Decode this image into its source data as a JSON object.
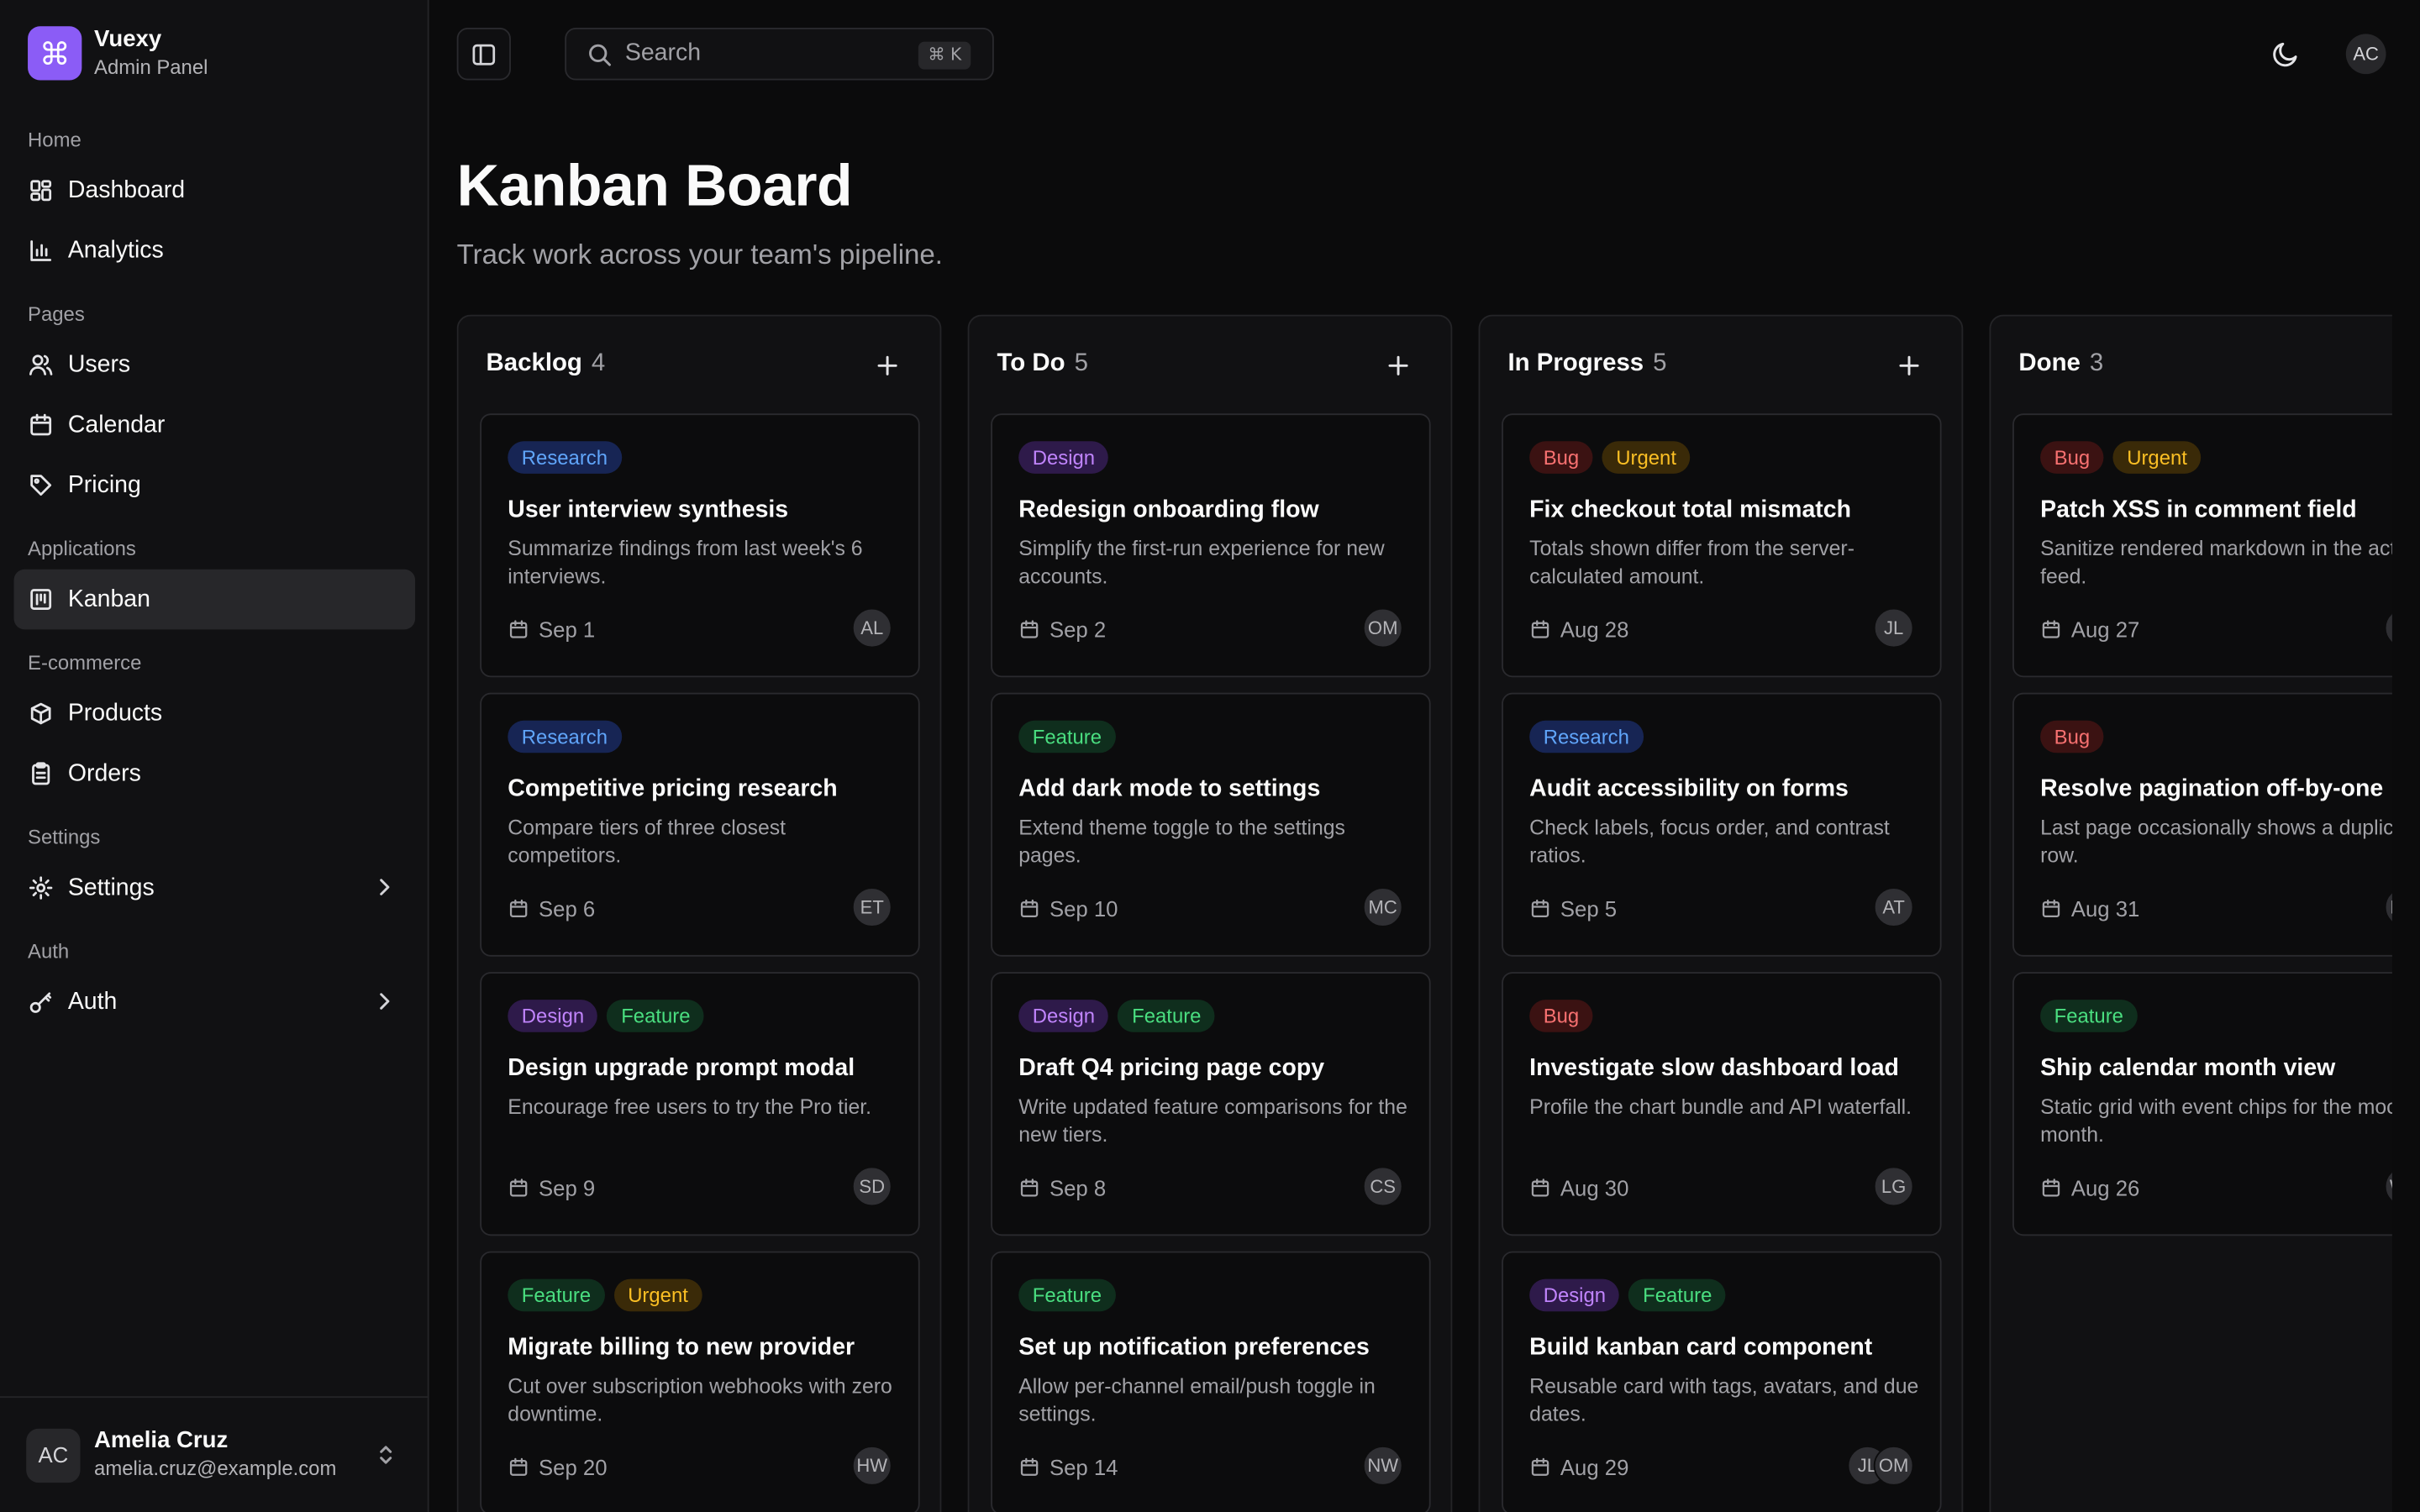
{
  "brand": {
    "logo_glyph": "⌘",
    "name": "Vuexy",
    "subtitle": "Admin Panel"
  },
  "sidebar": {
    "sections": [
      {
        "title": "Home",
        "items": [
          {
            "label": "Dashboard",
            "icon": "dashboard-icon"
          },
          {
            "label": "Analytics",
            "icon": "bar-chart-icon"
          }
        ]
      },
      {
        "title": "Pages",
        "items": [
          {
            "label": "Users",
            "icon": "users-icon"
          },
          {
            "label": "Calendar",
            "icon": "calendar-icon"
          },
          {
            "label": "Pricing",
            "icon": "tag-icon"
          }
        ]
      },
      {
        "title": "Applications",
        "items": [
          {
            "label": "Kanban",
            "icon": "kanban-icon",
            "active": true
          }
        ]
      },
      {
        "title": "E-commerce",
        "items": [
          {
            "label": "Products",
            "icon": "package-icon"
          },
          {
            "label": "Orders",
            "icon": "clipboard-icon"
          }
        ]
      },
      {
        "title": "Settings",
        "items": [
          {
            "label": "Settings",
            "icon": "gear-icon",
            "expandable": true
          }
        ]
      },
      {
        "title": "Auth",
        "items": [
          {
            "label": "Auth",
            "icon": "key-icon",
            "expandable": true
          }
        ]
      }
    ]
  },
  "user": {
    "initials": "AC",
    "name": "Amelia Cruz",
    "email": "amelia.cruz@example.com"
  },
  "topbar": {
    "search_placeholder": "Search",
    "search_shortcut": "⌘ K",
    "avatar_initials": "AC"
  },
  "page": {
    "title": "Kanban Board",
    "subtitle": "Track work across your team's pipeline."
  },
  "columns": [
    {
      "name": "Backlog",
      "count": "4",
      "cards": [
        {
          "tags": [
            "Research"
          ],
          "title": "User interview synthesis",
          "desc": "Summarize findings from last week's 6 interviews.",
          "date": "Sep 1",
          "assignees": [
            "AL"
          ]
        },
        {
          "tags": [
            "Research"
          ],
          "title": "Competitive pricing research",
          "desc": "Compare tiers of three closest competitors.",
          "date": "Sep 6",
          "assignees": [
            "ET"
          ]
        },
        {
          "tags": [
            "Design",
            "Feature"
          ],
          "title": "Design upgrade prompt modal",
          "desc": "Encourage free users to try the Pro tier.",
          "date": "Sep 9",
          "assignees": [
            "SD"
          ]
        },
        {
          "tags": [
            "Feature",
            "Urgent"
          ],
          "title": "Migrate billing to new provider",
          "desc": "Cut over subscription webhooks with zero downtime.",
          "date": "Sep 20",
          "assignees": [
            "HW"
          ]
        }
      ]
    },
    {
      "name": "To Do",
      "count": "5",
      "cards": [
        {
          "tags": [
            "Design"
          ],
          "title": "Redesign onboarding flow",
          "desc": "Simplify the first-run experience for new accounts.",
          "date": "Sep 2",
          "assignees": [
            "OM"
          ]
        },
        {
          "tags": [
            "Feature"
          ],
          "title": "Add dark mode to settings",
          "desc": "Extend theme toggle to the settings pages.",
          "date": "Sep 10",
          "assignees": [
            "MC"
          ]
        },
        {
          "tags": [
            "Design",
            "Feature"
          ],
          "title": "Draft Q4 pricing page copy",
          "desc": "Write updated feature comparisons for the new tiers.",
          "date": "Sep 8",
          "assignees": [
            "CS"
          ]
        },
        {
          "tags": [
            "Feature"
          ],
          "title": "Set up notification preferences",
          "desc": "Allow per-channel email/push toggle in settings.",
          "date": "Sep 14",
          "assignees": [
            "NW"
          ]
        }
      ]
    },
    {
      "name": "In Progress",
      "count": "5",
      "cards": [
        {
          "tags": [
            "Bug",
            "Urgent"
          ],
          "title": "Fix checkout total mismatch",
          "desc": "Totals shown differ from the server-calculated amount.",
          "date": "Aug 28",
          "assignees": [
            "JL"
          ]
        },
        {
          "tags": [
            "Research"
          ],
          "title": "Audit accessibility on forms",
          "desc": "Check labels, focus order, and contrast ratios.",
          "date": "Sep 5",
          "assignees": [
            "AT"
          ]
        },
        {
          "tags": [
            "Bug"
          ],
          "title": "Investigate slow dashboard load",
          "desc": "Profile the chart bundle and API waterfall.",
          "date": "Aug 30",
          "assignees": [
            "LG"
          ]
        },
        {
          "tags": [
            "Design",
            "Feature"
          ],
          "title": "Build kanban card component",
          "desc": "Reusable card with tags, avatars, and due dates.",
          "date": "Aug 29",
          "assignees": [
            "JL",
            "OM"
          ]
        }
      ]
    },
    {
      "name": "Done",
      "count": "3",
      "cards": [
        {
          "tags": [
            "Bug",
            "Urgent"
          ],
          "title": "Patch XSS in comment field",
          "desc": "Sanitize rendered markdown in the activity feed.",
          "date": "Aug 27",
          "assignees": [
            "JL"
          ]
        },
        {
          "tags": [
            "Bug"
          ],
          "title": "Resolve pagination off-by-one",
          "desc": "Last page occasionally shows a duplicate row.",
          "date": "Aug 31",
          "assignees": [
            "MC"
          ]
        },
        {
          "tags": [
            "Feature"
          ],
          "title": "Ship calendar month view",
          "desc": "Static grid with event chips for the mock month.",
          "date": "Aug 26",
          "assignees": [
            "WS"
          ]
        }
      ]
    }
  ]
}
